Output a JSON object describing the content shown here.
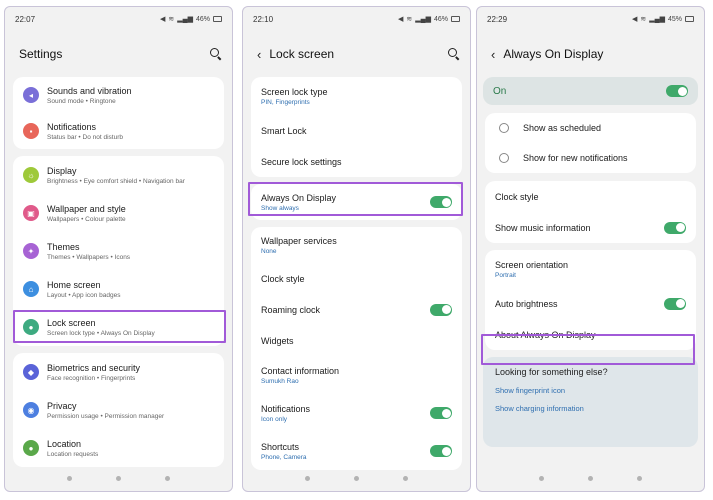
{
  "colors": {
    "accent": "#3fa96a",
    "highlight": "#a15ad8",
    "link": "#2f6fb0"
  },
  "screen1": {
    "time": "22:07",
    "battery": "46%",
    "title": "Settings",
    "items": [
      {
        "title": "Sounds and vibration",
        "sub": "Sound mode  •  Ringtone",
        "icon": "speaker-icon",
        "color": "#7a6fd8"
      },
      {
        "title": "Notifications",
        "sub": "Status bar  •  Do not disturb",
        "icon": "notification-icon",
        "color": "#e8665a"
      },
      {
        "title": "Display",
        "sub": "Brightness  •  Eye comfort shield  •  Navigation bar",
        "icon": "sun-icon",
        "color": "#9ec93a"
      },
      {
        "title": "Wallpaper and style",
        "sub": "Wallpapers  •  Colour palette",
        "icon": "image-icon",
        "color": "#e05a8a"
      },
      {
        "title": "Themes",
        "sub": "Themes  •  Wallpapers  •  Icons",
        "icon": "themes-icon",
        "color": "#a763d4"
      },
      {
        "title": "Home screen",
        "sub": "Layout  •  App icon badges",
        "icon": "home-icon",
        "color": "#3d8fe0"
      },
      {
        "title": "Lock screen",
        "sub": "Screen lock type  •  Always On Display",
        "icon": "lock-icon",
        "color": "#3daa80"
      },
      {
        "title": "Biometrics and security",
        "sub": "Face recognition  •  Fingerprints",
        "icon": "shield-icon",
        "color": "#5a63d8"
      },
      {
        "title": "Privacy",
        "sub": "Permission usage  •  Permission manager",
        "icon": "privacy-icon",
        "color": "#4d7fe0"
      },
      {
        "title": "Location",
        "sub": "Location requests",
        "icon": "location-icon",
        "color": "#5aa84a"
      }
    ]
  },
  "screen2": {
    "time": "22:10",
    "battery": "46%",
    "title": "Lock screen",
    "items": [
      {
        "title": "Screen lock type",
        "sub": "PIN, Fingerprints"
      },
      {
        "title": "Smart Lock",
        "sub": ""
      },
      {
        "title": "Secure lock settings",
        "sub": ""
      },
      {
        "title": "Always On Display",
        "sub": "Show always"
      },
      {
        "title": "Wallpaper services",
        "sub": "None"
      },
      {
        "title": "Clock style",
        "sub": ""
      },
      {
        "title": "Roaming clock",
        "sub": ""
      },
      {
        "title": "Widgets",
        "sub": ""
      },
      {
        "title": "Contact information",
        "sub": "Sumukh Rao"
      },
      {
        "title": "Notifications",
        "sub": "Icon only"
      },
      {
        "title": "Shortcuts",
        "sub": "Phone, Camera"
      }
    ]
  },
  "screen3": {
    "time": "22:29",
    "battery": "45%",
    "title": "Always On Display",
    "on_label": "On",
    "options": [
      "Show as scheduled",
      "Show for new notifications"
    ],
    "items": [
      {
        "title": "Clock style",
        "sub": ""
      },
      {
        "title": "Show music information",
        "sub": ""
      },
      {
        "title": "Screen orientation",
        "sub": "Portrait"
      },
      {
        "title": "Auto brightness",
        "sub": ""
      },
      {
        "title": "About Always On Display",
        "sub": ""
      }
    ],
    "suggest": {
      "question": "Looking for something else?",
      "links": [
        "Show fingerprint icon",
        "Show charging information"
      ]
    }
  }
}
